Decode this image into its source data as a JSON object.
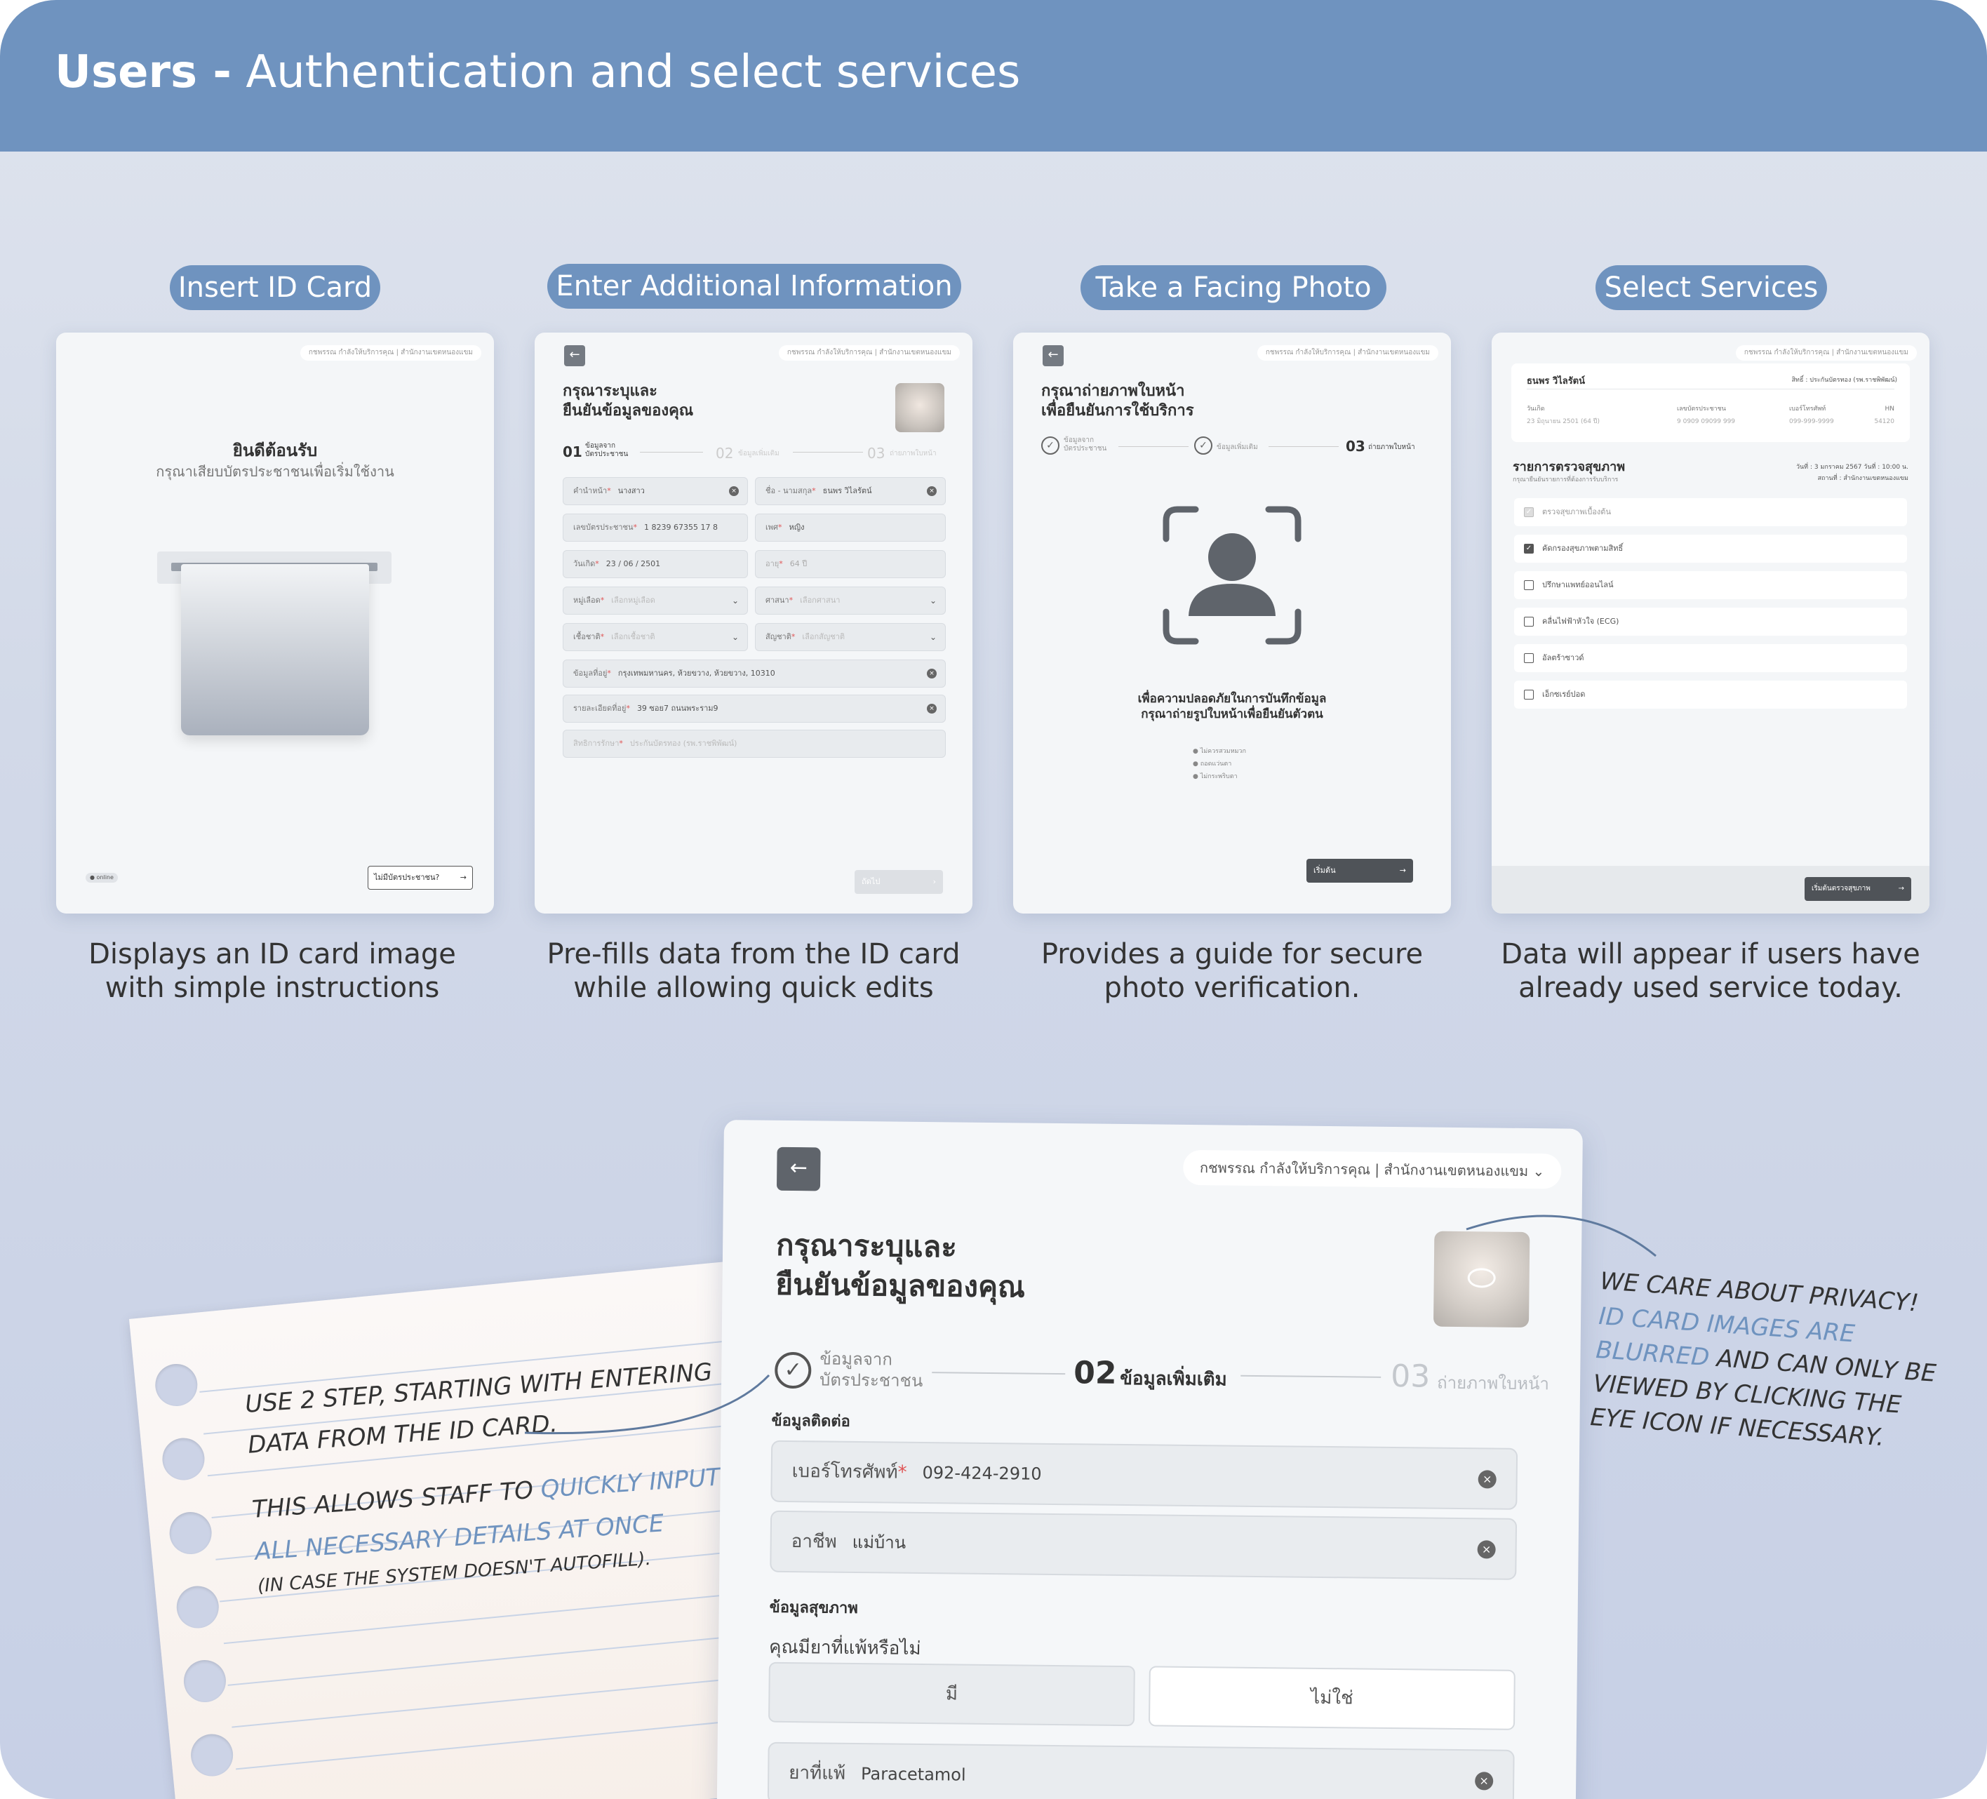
{
  "header": {
    "title_bold": "Users -",
    "title_rest": " Authentication and select services"
  },
  "colors": {
    "header": "#6f93bf",
    "accent_blue": "#6f93bf",
    "dark_button": "#4f5358",
    "required": "#e05555"
  },
  "steps": [
    {
      "label": "Insert ID Card",
      "caption_line1": "Displays an ID card image",
      "caption_line2": "with simple instructions"
    },
    {
      "label": "Enter Additional Information",
      "caption_line1": "Pre-fills data from the ID card",
      "caption_line2": "while allowing quick edits"
    },
    {
      "label": "Take a Facing Photo",
      "caption_line1": "Provides a guide for secure",
      "caption_line2": "photo verification."
    },
    {
      "label": "Select Services",
      "caption_line1": "Data will appear if users have",
      "caption_line2": "already used service today."
    }
  ],
  "topbar": {
    "staff": "กชพรรณ กำลังให้บริการคุณ | สำนักงานเขตหนองแขม"
  },
  "screen1": {
    "welcome": "ยินดีต้อนรับ",
    "instruction": "กรุณาเสียบบัตรประชาชนเพื่อเริ่มใช้งาน",
    "status": "● online",
    "no_card_button": "ไม่มีบัตรประชาชน?"
  },
  "screen2": {
    "title_line1": "กรุณาระบุและ",
    "title_line2": "ยืนยันข้อมูลของคุณ",
    "step1_num": "01",
    "step1_label_1": "ข้อมูลจาก",
    "step1_label_2": "บัตรประชาชน",
    "step2_num": "02",
    "step2_label": "ข้อมูลเพิ่มเติม",
    "step3_num": "03",
    "step3_label": "ถ่ายภาพใบหน้า",
    "fields": {
      "prefix_label": "คำนำหน้า",
      "prefix_value": "นางสาว",
      "name_label": "ชื่อ - นามสกุล",
      "name_value": "ธนพร วิไลรัตน์",
      "id_label": "เลขบัตรประชาชน",
      "id_value": "1 8239 67355 17 8",
      "gender_label": "เพศ",
      "gender_value": "หญิง",
      "dob_label": "วันเกิด",
      "dob_value": "23 / 06 / 2501",
      "age_label": "อายุ",
      "age_value": "64 ปี",
      "blood_label": "หมู่เลือด",
      "blood_placeholder": "เลือกหมู่เลือด",
      "religion_label": "ศาสนา",
      "religion_placeholder": "เลือกศาสนา",
      "race_label": "เชื้อชาติ",
      "race_placeholder": "เลือกเชื้อชาติ",
      "nation_label": "สัญชาติ",
      "nation_placeholder": "เลือกสัญชาติ",
      "address_label": "ข้อมูลที่อยู่",
      "address_value": "กรุงเทพมหานคร, ห้วยขวาง, ห้วยขวาง, 10310",
      "address_detail_label": "รายละเอียดที่อยู่",
      "address_detail_value": "39 ซอย7 ถนนพระราม9",
      "rights_label": "สิทธิการรักษา",
      "rights_placeholder": "ประกันบัตรทอง (รพ.ราชพิพัฒน์)"
    },
    "next_button": "ถัดไป"
  },
  "screen3": {
    "title_line1": "กรุณาถ่ายภาพใบหน้า",
    "title_line2": "เพื่อยืนยันการใช้บริการ",
    "step1_label_1": "ข้อมูลจาก",
    "step1_label_2": "บัตรประชาชน",
    "step2_label": "ข้อมูลเพิ่มเติม",
    "step3_num": "03",
    "step3_label": "ถ่ายภาพใบหน้า",
    "note_line1": "เพื่อความปลอดภัยในการบันทึกข้อมูล",
    "note_line2": "กรุณาถ่ายรูปใบหน้าเพื่อยืนยันตัวตน",
    "tips": [
      "ไม่ควรสวมหมวก",
      "ถอดแว่นตา",
      "ไม่กระพริบตา"
    ],
    "start_button": "เริ่มต้น"
  },
  "screen4": {
    "patient_name": "ธนพร วิไลรัตน์",
    "rights": "สิทธิ์ : ประกันบัตรทอง (รพ.ราชพิพัฒน์)",
    "dob_label": "วันเกิด",
    "dob_value": "23 มิถุนายน 2501 (64 ปี)",
    "id_label": "เลขบัตรประชาชน",
    "id_value": "9 0909 09099 999",
    "phone_label": "เบอร์โทรศัพท์",
    "phone_value": "099-999-9999",
    "hn_label": "HN",
    "hn_value": "54120",
    "section_title": "รายการตรวจสุขภาพ",
    "section_sub": "กรุณายืนยันรายการที่ต้องการรับบริการ",
    "date_line": "วันที่ : 3 มกราคม 2567 วันที่ : 10:00 น.",
    "place_line": "สถานที่ : สำนักงานเขตหนองแขม",
    "services": [
      {
        "label": "ตรวจสุขภาพเบื้องต้น",
        "checked": true,
        "disabled": true
      },
      {
        "label": "คัดกรองสุขภาพตามสิทธิ์",
        "checked": true,
        "disabled": false
      },
      {
        "label": "ปรึกษาแพทย์ออนไลน์",
        "checked": false,
        "disabled": false
      },
      {
        "label": "คลื่นไฟฟ้าหัวใจ (ECG)",
        "checked": false,
        "disabled": false
      },
      {
        "label": "อัลตร้าซาวด์",
        "checked": false,
        "disabled": false
      },
      {
        "label": "เอ็กซเรย์ปอด",
        "checked": false,
        "disabled": false
      }
    ],
    "start_button": "เริ่มต้นตรวจสุขภาพ"
  },
  "big": {
    "title_line1": "กรุณาระบุและ",
    "title_line2": "ยืนยันข้อมูลของคุณ",
    "step1_label_1": "ข้อมูลจาก",
    "step1_label_2": "บัตรประชาชน",
    "step2_num": "02",
    "step2_label": "ข้อมูลเพิ่มเติม",
    "step3_num": "03",
    "step3_label": "ถ่ายภาพใบหน้า",
    "contact_heading": "ข้อมูลติดต่อ",
    "phone_label": "เบอร์โทรศัพท์",
    "phone_value": "092-424-2910",
    "job_label": "อาชีพ",
    "job_value": "แม่บ้าน",
    "health_heading": "ข้อมูลสุขภาพ",
    "allergy_question": "คุณมียาที่แพ้หรือไม่",
    "yes_option": "มี",
    "no_option": "ไม่ใช่",
    "drug_label": "ยาที่แพ้",
    "drug_value": "Paracetamol"
  },
  "notes": {
    "left_line1": "USE 2 STEP, STARTING WITH ENTERING",
    "left_line2": "DATA FROM THE ID CARD.",
    "left_line3a": "THIS ALLOWS STAFF TO ",
    "left_line3b": "QUICKLY INPUT",
    "left_line4": "ALL NECESSARY DETAILS AT ONCE",
    "left_line5": "(IN CASE THE SYSTEM DOESN'T AUTOFILL).",
    "right_line1": "WE CARE ABOUT PRIVACY!",
    "right_line2": "ID CARD IMAGES ARE",
    "right_line3a": "BLURRED",
    "right_line3b": " AND CAN ONLY BE",
    "right_line4": "VIEWED BY CLICKING THE",
    "right_line5": "EYE ICON IF NECESSARY."
  }
}
